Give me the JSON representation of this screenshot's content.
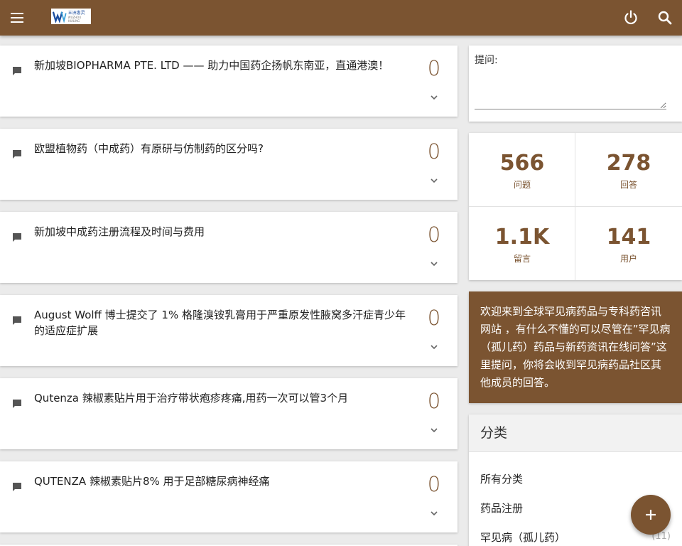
{
  "header": {
    "logo_text": "五洲惠灵",
    "logo_sub": "WUZHOU HUILING"
  },
  "questions": [
    {
      "title": "新加坡BIOPHARMA PTE. LTD —— 助力中国药企扬帆东南亚，直通港澳！",
      "answers": "0"
    },
    {
      "title": "欧盟植物药（中成药）有原研与仿制药的区分吗?",
      "answers": "0"
    },
    {
      "title": "新加坡中成药注册流程及时间与费用",
      "answers": "0"
    },
    {
      "title": "August Wolff 博士提交了 1% 格隆溴铵乳膏用于严重原发性腋窝多汗症青少年的适应症扩展",
      "answers": "0"
    },
    {
      "title": "Qutenza 辣椒素贴片用于治疗带状疱疹疼痛,用药一次可以管3个月",
      "answers": "0"
    },
    {
      "title": "QUTENZA 辣椒素贴片8% 用于足部糖尿病神经痛",
      "answers": "0"
    }
  ],
  "ask": {
    "label": "提问:",
    "value": ""
  },
  "stats": [
    {
      "value": "566",
      "label": "问题"
    },
    {
      "value": "278",
      "label": "回答"
    },
    {
      "value": "1.1K",
      "label": "留言"
    },
    {
      "value": "141",
      "label": "用户"
    }
  ],
  "welcome": {
    "text": "欢迎来到全球罕见病药品与专科药咨讯网站 ，有什么不懂的可以尽管在”罕见病（孤儿药）药品与新药资讯在线问答”这里提问，你将会收到罕见病药品社区其他成员的回答。"
  },
  "categories": {
    "title": "分类",
    "items": [
      {
        "label": "所有分类",
        "count": ""
      },
      {
        "label": "药品注册",
        "count": ""
      },
      {
        "label": "罕见病（孤儿药）",
        "count": "(11)"
      }
    ]
  },
  "colors": {
    "brand": "#7b5431",
    "background": "#ebebeb"
  },
  "icons": {
    "menu": "menu-icon",
    "power": "power-icon",
    "search": "search-icon",
    "question": "comment-icon",
    "expand": "chevron-down-icon",
    "add": "plus-icon"
  }
}
